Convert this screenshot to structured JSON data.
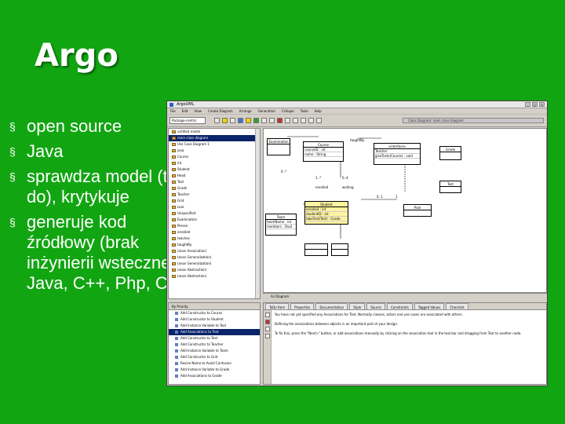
{
  "slide": {
    "title": "Argo",
    "bullets": [
      {
        "marker": "§",
        "text": "open source"
      },
      {
        "marker": "§",
        "text": "Java"
      },
      {
        "marker": "§",
        "text": "sprawdza model (to do), krytykuje"
      },
      {
        "marker": "§",
        "text": "generuje kod źródłowy (brak inżynierii wstecznej) Java, C++, Php, C#"
      }
    ]
  },
  "colors": {
    "slide_background": "#12a512",
    "title_text": "#ffffff",
    "selection": "#0a246a",
    "uml_highlight": "#fff3a0"
  },
  "argo_window": {
    "title": "ArgoUML",
    "window_buttons": [
      "_",
      "□",
      "x"
    ],
    "menu": [
      "File",
      "Edit",
      "View",
      "Create Diagram",
      "Arrange",
      "Generation",
      "Critique",
      "Tools",
      "Help"
    ],
    "perspective_select": "Package-centric",
    "toolbar_icons": [
      "select-icon",
      "class-icon",
      "association-icon",
      "generalization-icon",
      "note-icon",
      "zoom-icon"
    ],
    "diagram_title": "Class Diagram: main class diagram",
    "nav_tree": [
      {
        "label": "untitled model",
        "selected": false
      },
      {
        "label": "main class diagram",
        "selected": true
      },
      {
        "label": "Use Case Diagram 1",
        "selected": false
      },
      {
        "label": "java",
        "selected": false
      },
      {
        "label": "Course",
        "selected": false
      },
      {
        "label": "int",
        "selected": false
      },
      {
        "label": "Student",
        "selected": false
      },
      {
        "label": "Head",
        "selected": false
      },
      {
        "label": "Text",
        "selected": false
      },
      {
        "label": "Grade",
        "selected": false
      },
      {
        "label": "Teacher",
        "selected": false
      },
      {
        "label": "Grid",
        "selected": false
      },
      {
        "label": "Lear",
        "selected": false
      },
      {
        "label": "Unspecified",
        "selected": false
      },
      {
        "label": "Examination",
        "selected": false
      },
      {
        "label": "Person",
        "selected": false
      },
      {
        "label": "enrolled",
        "selected": false
      },
      {
        "label": "teaches",
        "selected": false
      },
      {
        "label": "taughtBy",
        "selected": false
      },
      {
        "label": "(anon Association)",
        "selected": false
      },
      {
        "label": "(anon Generalization)",
        "selected": false
      },
      {
        "label": "(anon Generalization)",
        "selected": false
      },
      {
        "label": "(anon Abstraction)",
        "selected": false
      },
      {
        "label": "(anon Abstraction)",
        "selected": false
      }
    ],
    "diagram": {
      "classes": [
        {
          "name": "Examination",
          "lines": []
        },
        {
          "name": "Course",
          "lines": [
            "courseID : int",
            "name : String"
          ]
        },
        {
          "name": "«interface»",
          "lines": [
            "Teacher",
            "giveTests(Course) : void"
          ]
        },
        {
          "name": "Grade",
          "lines": []
        },
        {
          "name": "Test",
          "lines": []
        },
        {
          "name": "Student",
          "lines": [
            "enrolled : int",
            "studentID : int",
            "takeTest(Test) : Grade"
          ]
        },
        {
          "name": "Team",
          "lines": [
            "teamName : int",
            "members : Stud"
          ]
        },
        {
          "name": "Pool",
          "lines": []
        }
      ],
      "labels": [
        "taughtBy",
        "0..*",
        "1..*",
        "0..4",
        "enrolled",
        "waiting",
        "0..1",
        "1"
      ],
      "tab": "As Diagram"
    },
    "todo": {
      "select": "By Priority",
      "items": [
        {
          "label": "Add Constructor to Course",
          "selected": false
        },
        {
          "label": "Add Constructor to Student",
          "selected": false
        },
        {
          "label": "Add Instance Variable to Text",
          "selected": false
        },
        {
          "label": "Add Associations to Text",
          "selected": true
        },
        {
          "label": "Add Constructor to Text",
          "selected": false
        },
        {
          "label": "Add Constructor to Teacher",
          "selected": false
        },
        {
          "label": "Add Instance Variable to Team",
          "selected": false
        },
        {
          "label": "Add Constructor to Grid",
          "selected": false
        },
        {
          "label": "Revise Name to Avoid Confusion",
          "selected": false
        },
        {
          "label": "Add Instance Variable to Grade",
          "selected": false
        },
        {
          "label": "Add Associations to Grade",
          "selected": false
        }
      ]
    },
    "details": {
      "tabs": [
        "ToDo Item",
        "Properties",
        "Documentation",
        "Style",
        "Source",
        "Constraints",
        "Tagged Values",
        "Checklist"
      ],
      "paragraphs": [
        "You have not yet specified any Associations for Text. Normally classes, actors and use cases are associated with others.",
        "Defining the associations between objects is an important part of your design.",
        "To fix this, press the \"Next>\" button, or add associations manually by clicking on the association tool in the tool bar and dragging from Text to another node."
      ]
    }
  }
}
